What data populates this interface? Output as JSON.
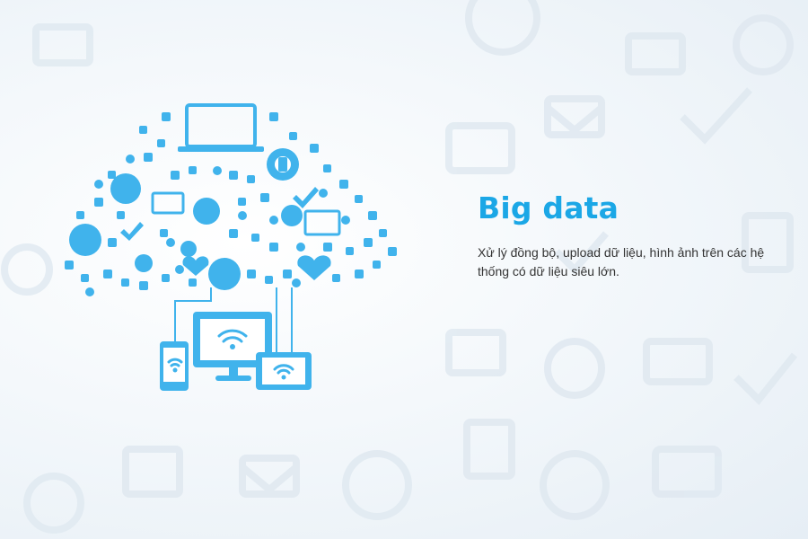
{
  "hero": {
    "title": "Big data",
    "description": "Xử lý đồng bộ, upload dữ liệu, hình ảnh trên các hệ thống có dữ liệu siêu lớn."
  },
  "illustration": {
    "icon": "cloud-network-icon",
    "devices": [
      "smartphone-icon",
      "monitor-icon",
      "tablet-icon"
    ],
    "accent_color": "#3fb2ec",
    "background_color": "#eef4f9"
  }
}
